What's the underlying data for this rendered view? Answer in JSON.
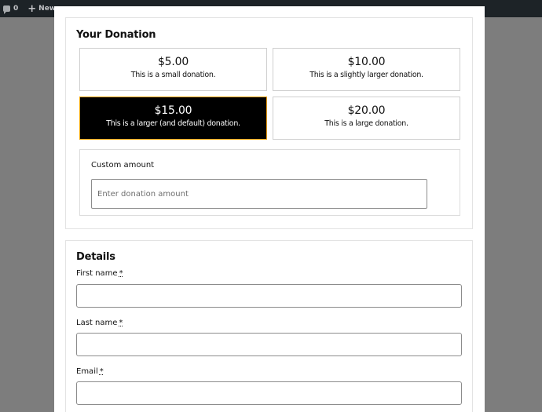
{
  "adminbar": {
    "comment_count": "0",
    "new_label": "New"
  },
  "donation": {
    "title": "Your Donation",
    "levels": [
      {
        "amount": "$5.00",
        "description": "This is a small donation.",
        "selected": false
      },
      {
        "amount": "$10.00",
        "description": "This is a slightly larger donation.",
        "selected": false
      },
      {
        "amount": "$15.00",
        "description": "This is a larger (and default) donation.",
        "selected": true
      },
      {
        "amount": "$20.00",
        "description": "This is a large donation.",
        "selected": false
      }
    ],
    "custom": {
      "label": "Custom amount",
      "placeholder": "Enter donation amount",
      "value": ""
    }
  },
  "details": {
    "title": "Details",
    "required_marker": "*",
    "fields": [
      {
        "label": "First name",
        "value": ""
      },
      {
        "label": "Last name",
        "value": ""
      },
      {
        "label": "Email",
        "value": ""
      }
    ]
  },
  "colors": {
    "overlay": "#7d7d7d",
    "adminbar": "#1d2327",
    "selected_bg": "#000000",
    "selected_border": "#f0a000"
  }
}
